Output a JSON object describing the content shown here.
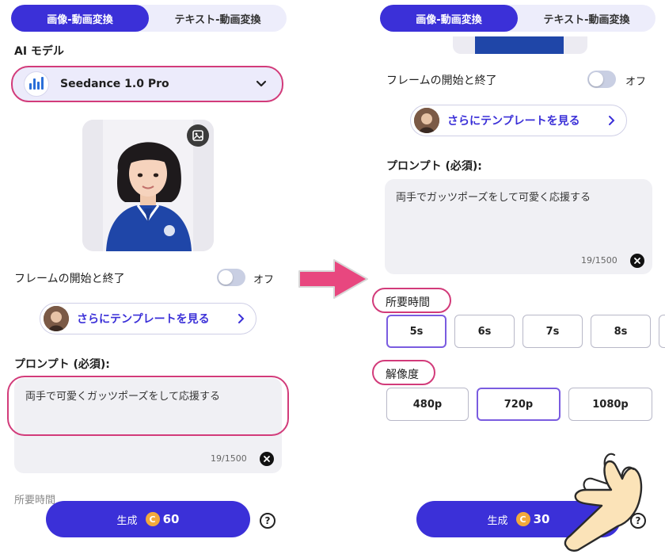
{
  "tabs": {
    "image_to_video": "画像-動画変換",
    "text_to_video": "テキスト-動画変換"
  },
  "left": {
    "ai_model_label": "AI モデル",
    "model_name": "Seedance 1.0 Pro",
    "frame_label": "フレームの開始と終了",
    "toggle_state": "オフ",
    "template_text": "さらにテンプレートを見る",
    "prompt_label": "プロンプト (必須):",
    "prompt_text": "両手で可愛くガッツポーズをして応援する",
    "counter": "19/1500",
    "duration_label_faded": "所要時間",
    "generate_label": "生成",
    "coin_symbol": "C",
    "cost": "60",
    "help": "?"
  },
  "right": {
    "frame_label": "フレームの開始と終了",
    "toggle_state": "オフ",
    "template_text": "さらにテンプレートを見る",
    "prompt_label": "プロンプト (必須):",
    "prompt_text": "両手でガッツポーズをして可愛く応援する",
    "counter": "19/1500",
    "duration_label": "所要時間",
    "durations": [
      "5s",
      "6s",
      "7s",
      "8s"
    ],
    "duration_selected": "5s",
    "resolution_label": "解像度",
    "resolutions": [
      "480p",
      "720p",
      "1080p"
    ],
    "resolution_selected": "720p",
    "generate_label": "生成",
    "coin_symbol": "C",
    "cost": "30",
    "help": "?"
  },
  "colors": {
    "accent": "#3b30d8",
    "highlight": "#d23b7a",
    "coin": "#f2a93b",
    "arrow": "#e8477f"
  }
}
